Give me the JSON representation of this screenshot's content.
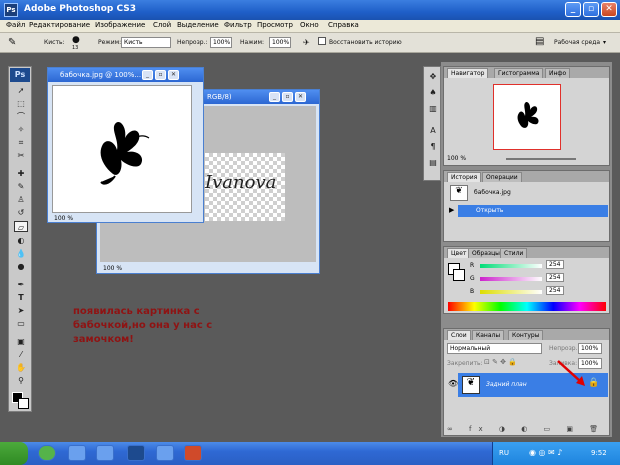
{
  "window": {
    "title": "Adobe Photoshop CS3"
  },
  "menu": [
    "Файл",
    "Редактирование",
    "Изображение",
    "Слой",
    "Выделение",
    "Фильтр",
    "Просмотр",
    "Окно",
    "Справка"
  ],
  "options": {
    "brush_label": "Кисть:",
    "brush_size": "13",
    "mode_label": "Режим:",
    "mode_value": "Кисть",
    "opacity_label": "Непрозр.:",
    "opacity_value": "100%",
    "pressure_label": "Нажим:",
    "pressure_value": "100%",
    "restore_label": "Восстановить историю",
    "workspace": "Рабочая среда"
  },
  "doc_front": {
    "title": "бабочка.jpg @ 100%...",
    "zoom": "100 %"
  },
  "doc_back": {
    "title": "RGB/8)",
    "zoom": "100 %",
    "text": "Ivanova"
  },
  "navigator": {
    "tabs": [
      "Навигатор",
      "Гистограмма",
      "Инфо"
    ],
    "zoom": "100 %"
  },
  "history": {
    "tabs": [
      "История",
      "Операции"
    ],
    "file": "бабочка.jpg",
    "step": "Открыть"
  },
  "color": {
    "tabs": [
      "Цвет",
      "Образцы",
      "Стили"
    ],
    "channels": [
      {
        "name": "R",
        "value": "254",
        "color": "#00cc66"
      },
      {
        "name": "G",
        "value": "254",
        "color": "#cc22cc"
      },
      {
        "name": "B",
        "value": "254",
        "color": "#dddd00"
      }
    ]
  },
  "layers": {
    "tabs": [
      "Слои",
      "Каналы",
      "Контуры"
    ],
    "blend": "Нормальный",
    "opacity_label": "Непрозр.:",
    "opacity": "100%",
    "lock_label": "Закрепить:",
    "fill_label": "Заливка:",
    "fill": "100%",
    "layer_name": "Задний план"
  },
  "caption": "появилась картинка с бабочкой,но она у нас с замочком!",
  "taskbar": {
    "lang": "RU",
    "time": "9:52"
  }
}
